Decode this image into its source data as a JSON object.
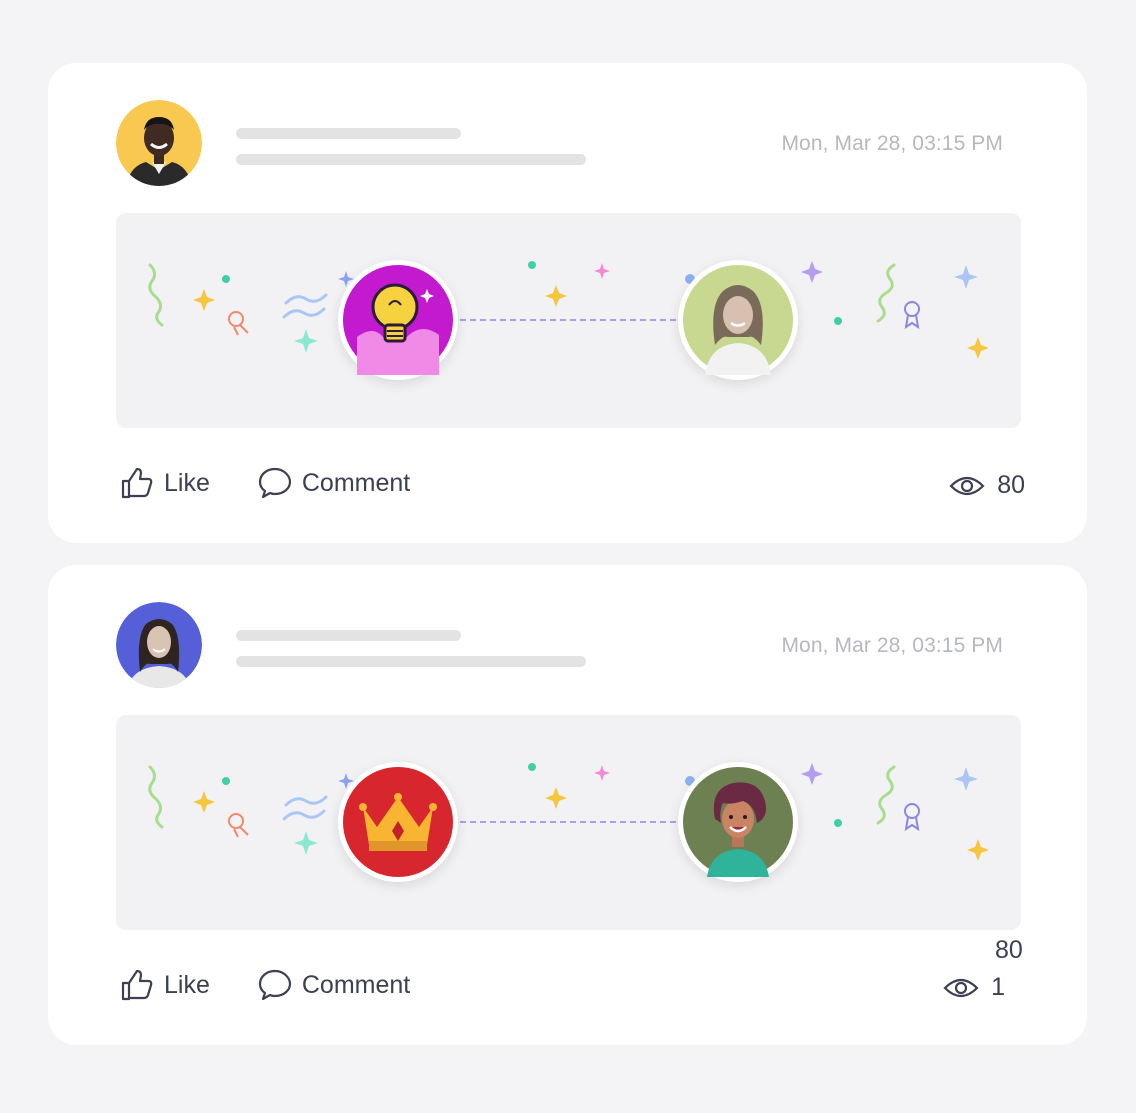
{
  "posts": [
    {
      "avatar_icon": "man-portrait-avatar",
      "avatar_bg": "#f9c850",
      "timestamp": "Mon, Mar 28, 03:15 PM",
      "badge_icon": "lightbulb-badge-icon",
      "badge_color": "#c31ad0",
      "recipient_icon": "woman-portrait-avatar",
      "recipient_bg": "#c8d890",
      "like_label": "Like",
      "comment_label": "Comment",
      "views": "80"
    },
    {
      "avatar_icon": "woman-portrait-avatar",
      "avatar_bg": "#5560d8",
      "timestamp": "Mon, Mar 28, 03:15 PM",
      "badge_icon": "crown-badge-icon",
      "badge_color": "#d7262e",
      "recipient_icon": "illustrated-woman-avatar",
      "recipient_bg": "#6d8052",
      "like_label": "Like",
      "comment_label": "Comment",
      "views": "1"
    }
  ],
  "stray_view_count": "80"
}
